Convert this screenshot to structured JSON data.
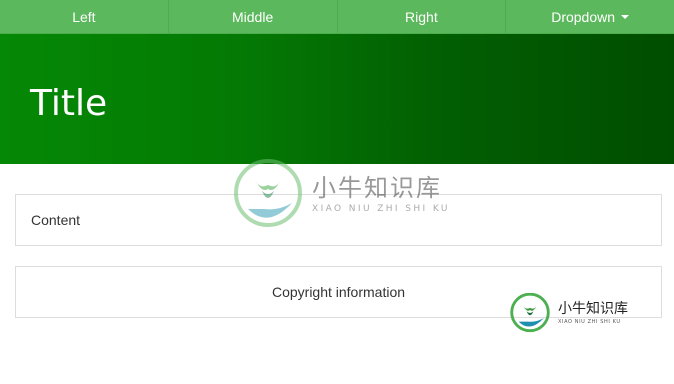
{
  "nav": {
    "items": [
      {
        "label": "Left"
      },
      {
        "label": "Middle"
      },
      {
        "label": "Right"
      },
      {
        "label": "Dropdown"
      }
    ],
    "background": "#5cb85c"
  },
  "header": {
    "title": "Title",
    "gradient_start": "#058805",
    "gradient_end": "#004d00"
  },
  "main": {
    "content_text": "Content"
  },
  "footer": {
    "text": "Copyright information"
  },
  "watermark": {
    "cn": "小牛知识库",
    "en": "XIAO NIU ZHI SHI KU",
    "colors": [
      "#4caf50",
      "#3aa0b8"
    ]
  }
}
